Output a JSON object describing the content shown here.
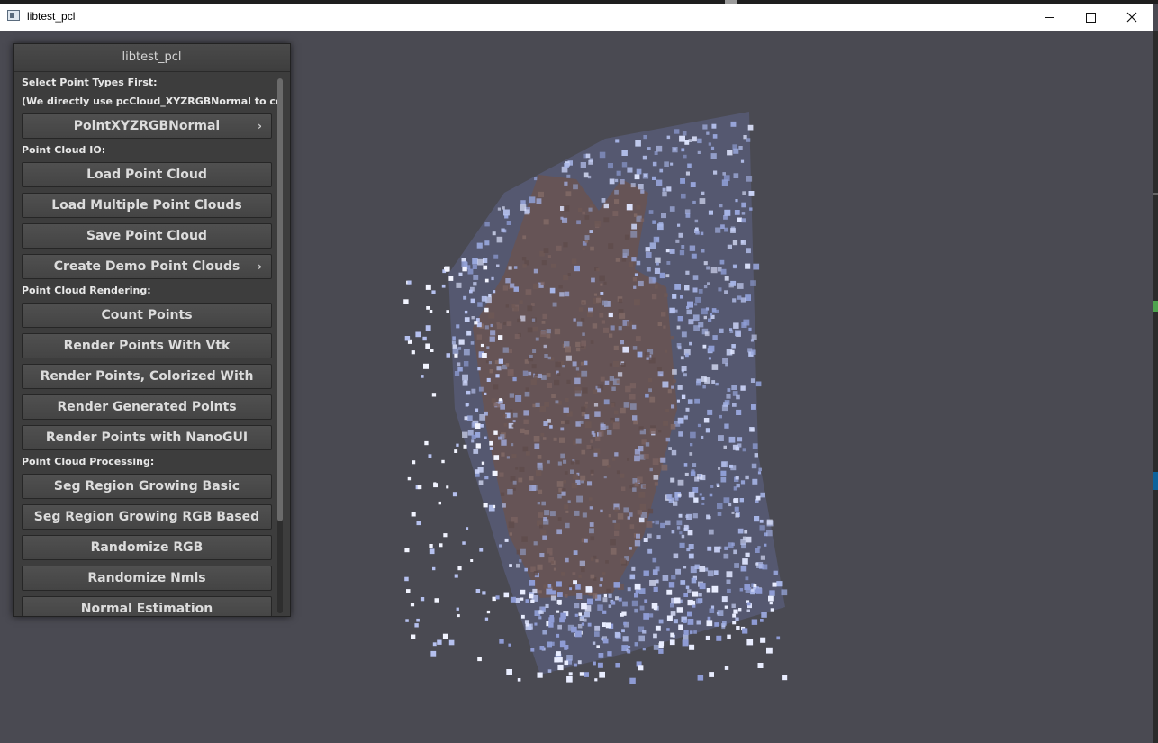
{
  "window": {
    "title": "libtest_pcl"
  },
  "panel": {
    "title": "libtest_pcl",
    "select_label": "Select Point Types First:",
    "note": "(We directly use pcCloud_XYZRGBNormal  to compute",
    "point_type_button": "PointXYZRGBNormal",
    "sections": {
      "io": "Point Cloud IO:",
      "rendering": "Point Cloud Rendering:",
      "processing": "Point Cloud Processing:"
    },
    "buttons": {
      "load": "Load Point Cloud",
      "load_multiple": "Load Multiple Point Clouds",
      "save": "Save Point Cloud",
      "create_demo": "Create Demo Point Clouds",
      "count": "Count Points",
      "render_vtk": "Render Points With Vtk",
      "render_normal": "Render Points, Colorized With Normal",
      "render_generated": "Render Generated Points",
      "render_nanogui": "Render Points with NanoGUI",
      "seg_basic": "Seg Region Growing Basic",
      "seg_rgb": "Seg Region Growing RGB Based",
      "randomize_rgb": "Randomize RGB",
      "randomize_nmls": "Randomize Nmls",
      "normal_estimation": "Normal Estimation"
    }
  },
  "icons": {
    "submenu": "chevron-right-icon",
    "window_controls": [
      "minimize-icon",
      "maximize-icon",
      "close-icon"
    ]
  },
  "colors": {
    "viewport_bg": "#4a4a52",
    "panel_bg": "#3d3d3d",
    "button_bg": "#4a4a4a",
    "cloud_light": "#b8c4ee",
    "cloud_skin": "#6b5552"
  }
}
